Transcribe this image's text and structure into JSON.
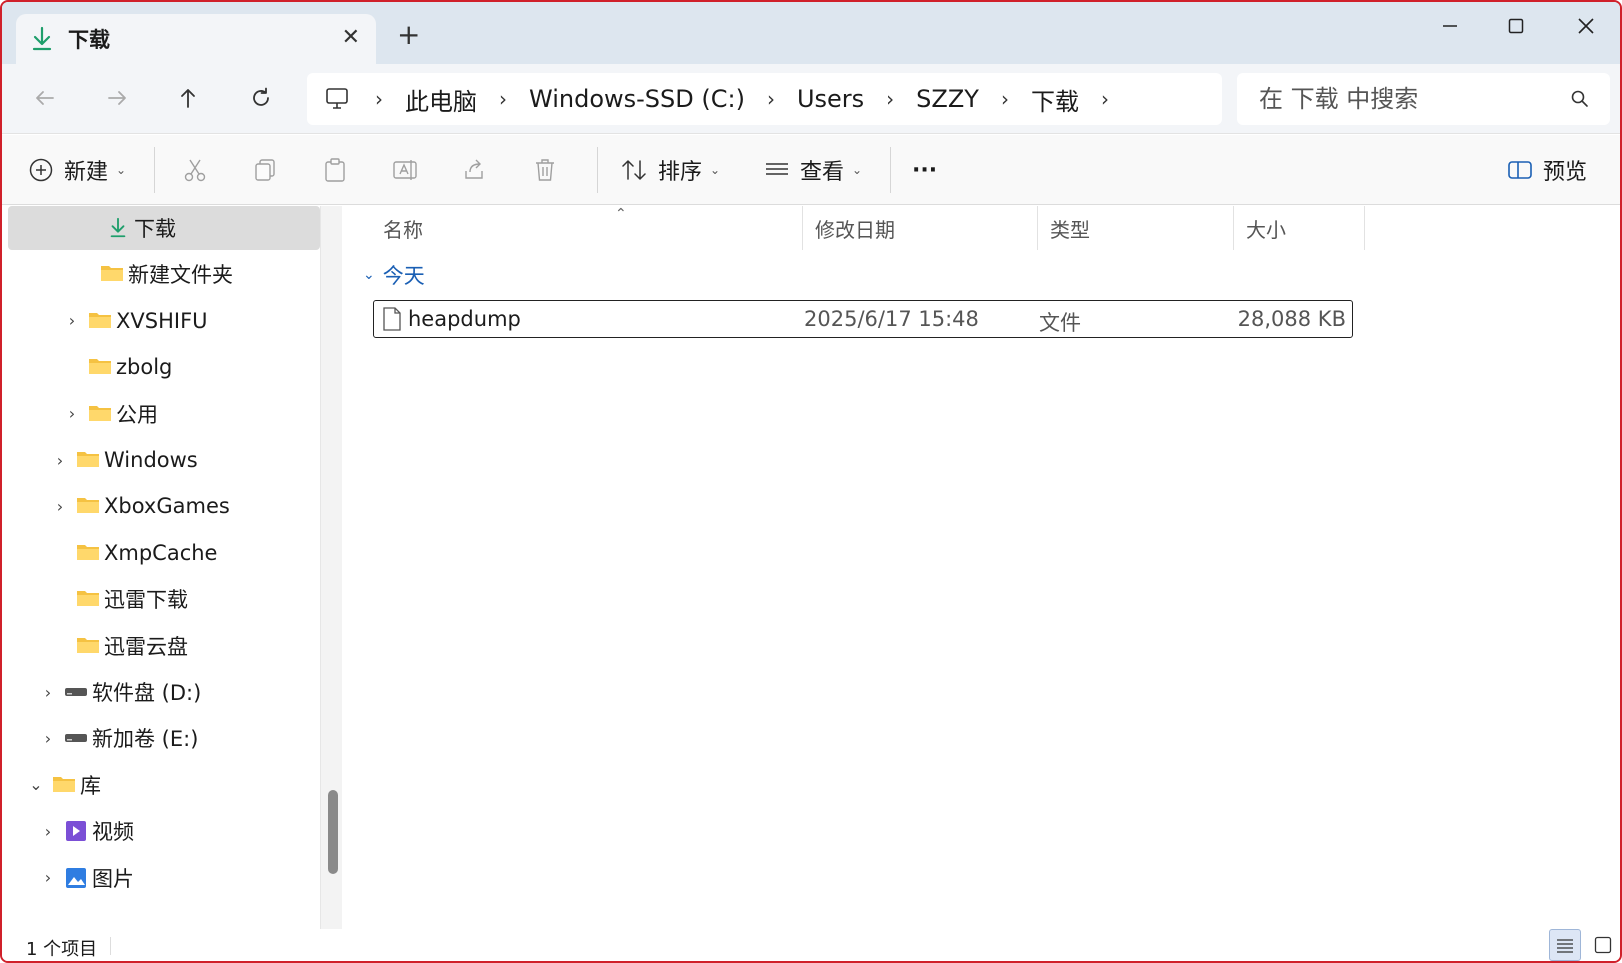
{
  "titlebar": {
    "tab_title": "下载",
    "tab_close": "✕",
    "new_tab": "+"
  },
  "addressbar": {
    "crumbs": [
      "此电脑",
      "Windows-SSD (C:)",
      "Users",
      "SZZY",
      "下载"
    ],
    "separator": "›",
    "search_placeholder": "在 下载 中搜索"
  },
  "toolbar": {
    "new_label": "新建",
    "sort_label": "排序",
    "view_label": "查看",
    "more_label": "···",
    "preview_label": "预览",
    "caret": "⌄"
  },
  "sidebar": {
    "items": [
      {
        "label": "下载",
        "chevron": "",
        "icon": "download-icon",
        "selected": true
      },
      {
        "label": "新建文件夹",
        "chevron": "",
        "icon": "folder-icon"
      },
      {
        "label": "XVSHIFU",
        "chevron": "›",
        "icon": "folder-icon"
      },
      {
        "label": "zbolg",
        "chevron": "",
        "icon": "folder-icon"
      },
      {
        "label": "公用",
        "chevron": "›",
        "icon": "folder-icon"
      },
      {
        "label": "Windows",
        "chevron": "›",
        "icon": "folder-icon"
      },
      {
        "label": "XboxGames",
        "chevron": "›",
        "icon": "folder-icon"
      },
      {
        "label": "XmpCache",
        "chevron": "",
        "icon": "folder-icon"
      },
      {
        "label": "迅雷下载",
        "chevron": "",
        "icon": "folder-icon"
      },
      {
        "label": "迅雷云盘",
        "chevron": "",
        "icon": "folder-icon"
      },
      {
        "label": "软件盘 (D:)",
        "chevron": "›",
        "icon": "drive-icon"
      },
      {
        "label": "新加卷 (E:)",
        "chevron": "›",
        "icon": "drive-icon"
      },
      {
        "label": "库",
        "chevron": "⌄",
        "icon": "library-icon"
      },
      {
        "label": "视频",
        "chevron": "›",
        "icon": "video-icon"
      },
      {
        "label": "图片",
        "chevron": "›",
        "icon": "picture-icon"
      }
    ]
  },
  "content": {
    "columns": [
      "名称",
      "修改日期",
      "类型",
      "大小"
    ],
    "sort_arrow": "⌃",
    "group_label": "今天",
    "group_chevron": "⌄",
    "files": [
      {
        "name": "heapdump",
        "modified": "2025/6/17 15:48",
        "type": "文件",
        "size": "28,088 KB"
      }
    ]
  },
  "statusbar": {
    "item_count": "1 个项目"
  },
  "colors": {
    "accent": "#1a5fb4",
    "folder": "#f5c242",
    "border_highlight": "#d0202a"
  }
}
